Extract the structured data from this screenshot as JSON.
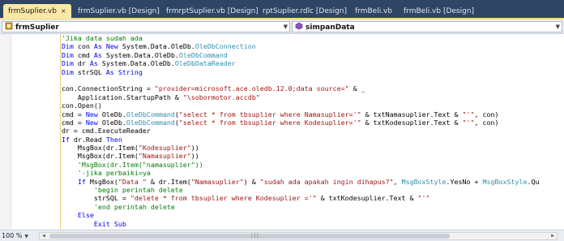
{
  "tabs": [
    {
      "label": "frmSuplier.vb",
      "close": "×",
      "active": true
    },
    {
      "label": "frmSuplier.vb [Design]"
    },
    {
      "label": "frmrptSuplier.vb [Design]"
    },
    {
      "label": "rptSuplier.rdlc [Design]"
    },
    {
      "label": "frmBeli.vb"
    },
    {
      "label": "frmBeli.vb [Design]"
    }
  ],
  "navbar": {
    "class_combo": "frmSuplier",
    "method_combo": "simpanData"
  },
  "code_lines": [
    [
      [
        "com",
        "            'Jika data sudah ada"
      ]
    ],
    [
      [
        "kw",
        "            Dim"
      ],
      [
        "plain",
        " con "
      ],
      [
        "kw",
        "As New"
      ],
      [
        "plain",
        " System.Data.OleDb."
      ],
      [
        "type",
        "OleDbConnection"
      ]
    ],
    [
      [
        "kw",
        "            Dim"
      ],
      [
        "plain",
        " cmd "
      ],
      [
        "kw",
        "As"
      ],
      [
        "plain",
        " System.Data.OleDb."
      ],
      [
        "type",
        "OleDbCommand"
      ]
    ],
    [
      [
        "kw",
        "            Dim"
      ],
      [
        "plain",
        " dr "
      ],
      [
        "kw",
        "As"
      ],
      [
        "plain",
        " System.Data.OleDb."
      ],
      [
        "type",
        "OleDbDataReader"
      ]
    ],
    [
      [
        "kw",
        "            Dim"
      ],
      [
        "plain",
        " strSQL "
      ],
      [
        "kw",
        "As String"
      ]
    ],
    [
      [
        "plain",
        ""
      ]
    ],
    [
      [
        "plain",
        "            con.ConnectionString = "
      ],
      [
        "str",
        "\"provider=microsoft.ace.oledb.12.0;data source=\""
      ],
      [
        "plain",
        " & _"
      ]
    ],
    [
      [
        "plain",
        "                Application.StartupPath & "
      ],
      [
        "str",
        "\"\\sobormotor.accdb\""
      ]
    ],
    [
      [
        "plain",
        "            con.Open()"
      ]
    ],
    [
      [
        "plain",
        "            cmd = "
      ],
      [
        "kw",
        "New"
      ],
      [
        "plain",
        " OleDb."
      ],
      [
        "type",
        "OleDbCommand"
      ],
      [
        "plain",
        "("
      ],
      [
        "str",
        "\"select * from tbsuplier where Namasuplier='\""
      ],
      [
        "plain",
        " & txtNamasuplier.Text & "
      ],
      [
        "str",
        "\"'\""
      ],
      [
        "plain",
        ", con)"
      ]
    ],
    [
      [
        "plain",
        "            cmd = "
      ],
      [
        "kw",
        "New"
      ],
      [
        "plain",
        " OleDb."
      ],
      [
        "type",
        "OleDbCommand"
      ],
      [
        "plain",
        "("
      ],
      [
        "str",
        "\"select * from tbsuplier where Kodesuplier='\""
      ],
      [
        "plain",
        " & txtKodesuplier.Text & "
      ],
      [
        "str",
        "\"'\""
      ],
      [
        "plain",
        ", con)"
      ]
    ],
    [
      [
        "plain",
        "            dr = cmd.ExecuteReader"
      ]
    ],
    [
      [
        "kw",
        "            If"
      ],
      [
        "plain",
        " dr.Read "
      ],
      [
        "kw",
        "Then"
      ]
    ],
    [
      [
        "plain",
        "                MsgBox(dr.Item("
      ],
      [
        "str",
        "\"Kodesuplier\""
      ],
      [
        "plain",
        "))"
      ]
    ],
    [
      [
        "plain",
        "                MsgBox(dr.Item("
      ],
      [
        "str",
        "\"Namasuplier\""
      ],
      [
        "plain",
        "))"
      ]
    ],
    [
      [
        "com",
        "                'MsgBox(dr.Item(\"namasuplier\"))"
      ]
    ],
    [
      [
        "com",
        "                '-jika perbaiki=ya"
      ]
    ],
    [
      [
        "kw",
        "                If"
      ],
      [
        "plain",
        " MsgBox("
      ],
      [
        "str",
        "\"Data \""
      ],
      [
        "plain",
        " & dr.Item("
      ],
      [
        "str",
        "\"Namasuplier\""
      ],
      [
        "plain",
        ") & "
      ],
      [
        "str",
        "\"sudah ada apakah ingin dihapus?\""
      ],
      [
        "plain",
        ", "
      ],
      [
        "type",
        "MsgBoxStyle"
      ],
      [
        "plain",
        ".YesNo + "
      ],
      [
        "type",
        "MsgBoxStyle"
      ],
      [
        "plain",
        ".Qu"
      ]
    ],
    [
      [
        "com",
        "                    'begin perintah delete"
      ]
    ],
    [
      [
        "plain",
        "                    strSQL = "
      ],
      [
        "str",
        "\"delete * from tbsuplier where Kodesuplier ='\""
      ],
      [
        "plain",
        " & txtKodesuplier.Text & "
      ],
      [
        "str",
        "\"'\""
      ]
    ],
    [
      [
        "com",
        "                    'end perintah delete"
      ]
    ],
    [
      [
        "kw",
        "                Else"
      ]
    ],
    [
      [
        "kw",
        "                    Exit Sub"
      ]
    ],
    [
      [
        "plain",
        ""
      ]
    ],
    [
      [
        "kw",
        "                End If"
      ]
    ]
  ],
  "status": {
    "zoom": "100 %"
  }
}
